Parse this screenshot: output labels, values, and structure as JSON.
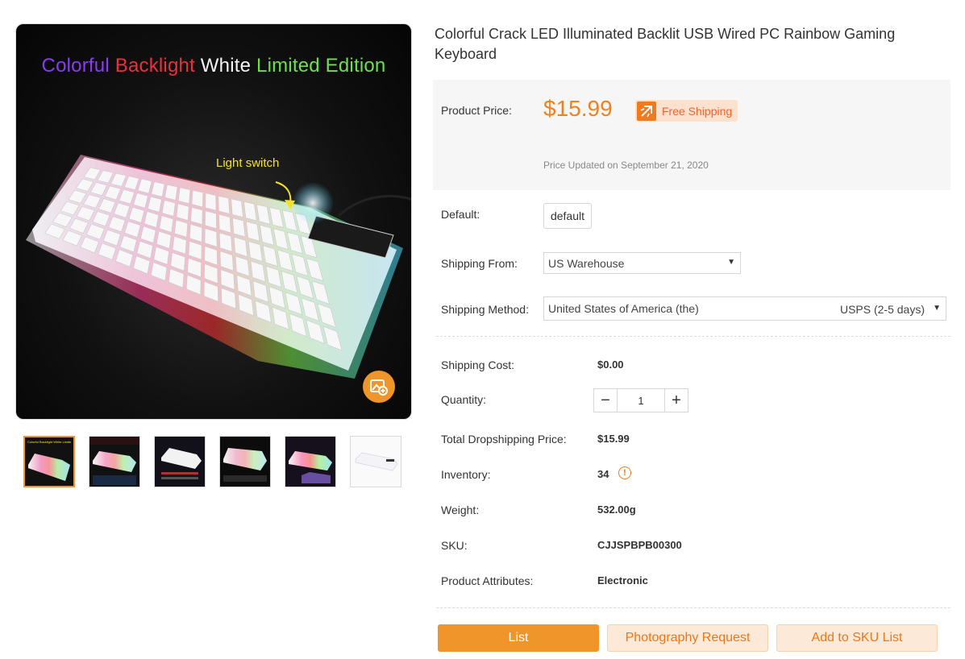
{
  "product": {
    "title": "Colorful Crack LED Illuminated Backlit USB Wired PC Rainbow Gaming Keyboard",
    "image_banner": {
      "word1": "Colorful",
      "word2": "Backlight",
      "word3": "White",
      "word4": "Limited Edition"
    },
    "image_callout": "Light switch",
    "thumbnail_banner": "Colorful Backlight White Limited Edition"
  },
  "price_section": {
    "label": "Product Price:",
    "price": "$15.99",
    "free_shipping": "Free Shipping",
    "updated": "Price Updated on September 21, 2020"
  },
  "options": {
    "default_label": "Default:",
    "default_value": "default",
    "shipping_from_label": "Shipping From:",
    "shipping_from_value": "US Warehouse",
    "shipping_method_label": "Shipping Method:",
    "shipping_method_country": "United States of America (the)",
    "shipping_method_service": "USPS (2-5 days)"
  },
  "details": {
    "shipping_cost_label": "Shipping Cost:",
    "shipping_cost": "$0.00",
    "quantity_label": "Quantity:",
    "quantity": "1",
    "total_label": "Total Dropshipping Price:",
    "total": "$15.99",
    "inventory_label": "Inventory:",
    "inventory": "34",
    "weight_label": "Weight:",
    "weight": "532.00g",
    "sku_label": "SKU:",
    "sku": "CJJSPBPB00300",
    "attributes_label": "Product Attributes:",
    "attributes": "Electronic"
  },
  "actions": {
    "list": "List",
    "photography": "Photography Request",
    "add_sku": "Add to SKU List"
  },
  "icons": {
    "free_shipping": "plane-icon",
    "zoom": "image-search-icon",
    "inventory_warning": "exclamation-circle-icon",
    "select_caret": "caret-down-icon"
  },
  "colors": {
    "accent": "#f0952a",
    "price": "#f0811e"
  }
}
